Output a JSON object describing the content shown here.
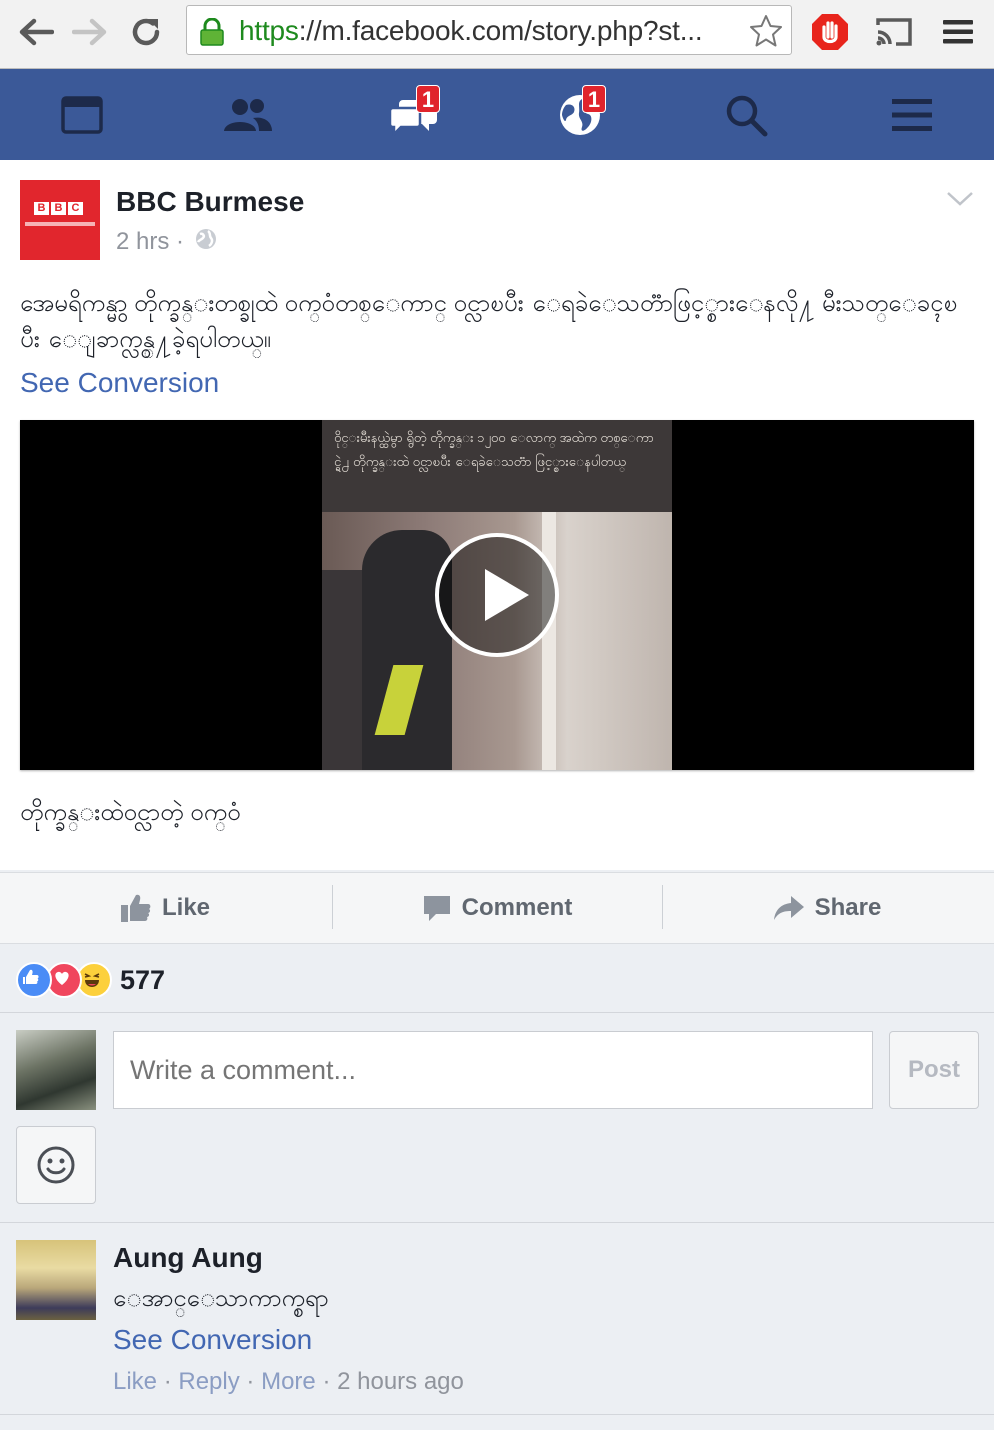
{
  "browser": {
    "url_scheme": "https",
    "url_rest": "://m.facebook.com/story.php?st..."
  },
  "navbar": {
    "tabs": [
      {
        "name": "news-feed",
        "icon": "news-feed-icon",
        "badge": ""
      },
      {
        "name": "friend-requests",
        "icon": "friends-icon",
        "badge": ""
      },
      {
        "name": "messages",
        "icon": "messages-icon",
        "badge": "1"
      },
      {
        "name": "notifications",
        "icon": "globe-icon",
        "badge": "1"
      },
      {
        "name": "search",
        "icon": "search-icon",
        "badge": ""
      },
      {
        "name": "menu",
        "icon": "menu-icon",
        "badge": ""
      }
    ]
  },
  "post": {
    "author": "BBC Burmese",
    "time": "2 hrs",
    "privacy_separator": "·",
    "text": "အေမရိကန္မွာ တိုက္ခန္းတစ္ခုထဲ ဝက္ဝံတစ္ေကာင္ ဝင္လာၿပီး ေရခဲေသတၱာဖြင့္စားေနလို႔ မီးသတ္ေခၚၿပီး ေျခာက္လွန္႔ခဲ့ရပါတယ္။",
    "see_conversion": "See Conversion",
    "video_caption": "ဝိုင္းမီးနယ္ထဲမွာ ရွိတဲ့ တိုက္ခန္း ၁၂၀၀ ေလာက္ အထဲက တစ္ေကာင္ရဲ႕ တိုက္ခန္းထဲ ဝင္လာၿပီး ေရခဲေသတၱာ ဖြင့္စားေနပါတယ္",
    "video_title": "တိုက္ခန္းထဲဝင္လာတဲ့ ဝက္ဝံ",
    "logo_letters": [
      "B",
      "B",
      "C"
    ]
  },
  "actions": {
    "like": "Like",
    "comment": "Comment",
    "share": "Share"
  },
  "reactions": {
    "count": "577",
    "types": [
      "like",
      "love",
      "haha"
    ],
    "colors": {
      "like": "#4a8cf6",
      "love": "#f0465d",
      "haha": "#fcd03c"
    }
  },
  "composer": {
    "placeholder": "Write a comment...",
    "post_label": "Post"
  },
  "comment": {
    "author": "Aung Aung",
    "text": "ေအာင္ေသာကာက္စရာ",
    "see_conversion": "See Conversion",
    "like": "Like",
    "reply": "Reply",
    "more": "More",
    "time": "2 hours ago",
    "sep": "·"
  },
  "colors": {
    "brand_blue": "#3b5998",
    "link_blue": "#4267b2",
    "badge_red": "#e0242c",
    "bbc_red": "#e1262d"
  }
}
